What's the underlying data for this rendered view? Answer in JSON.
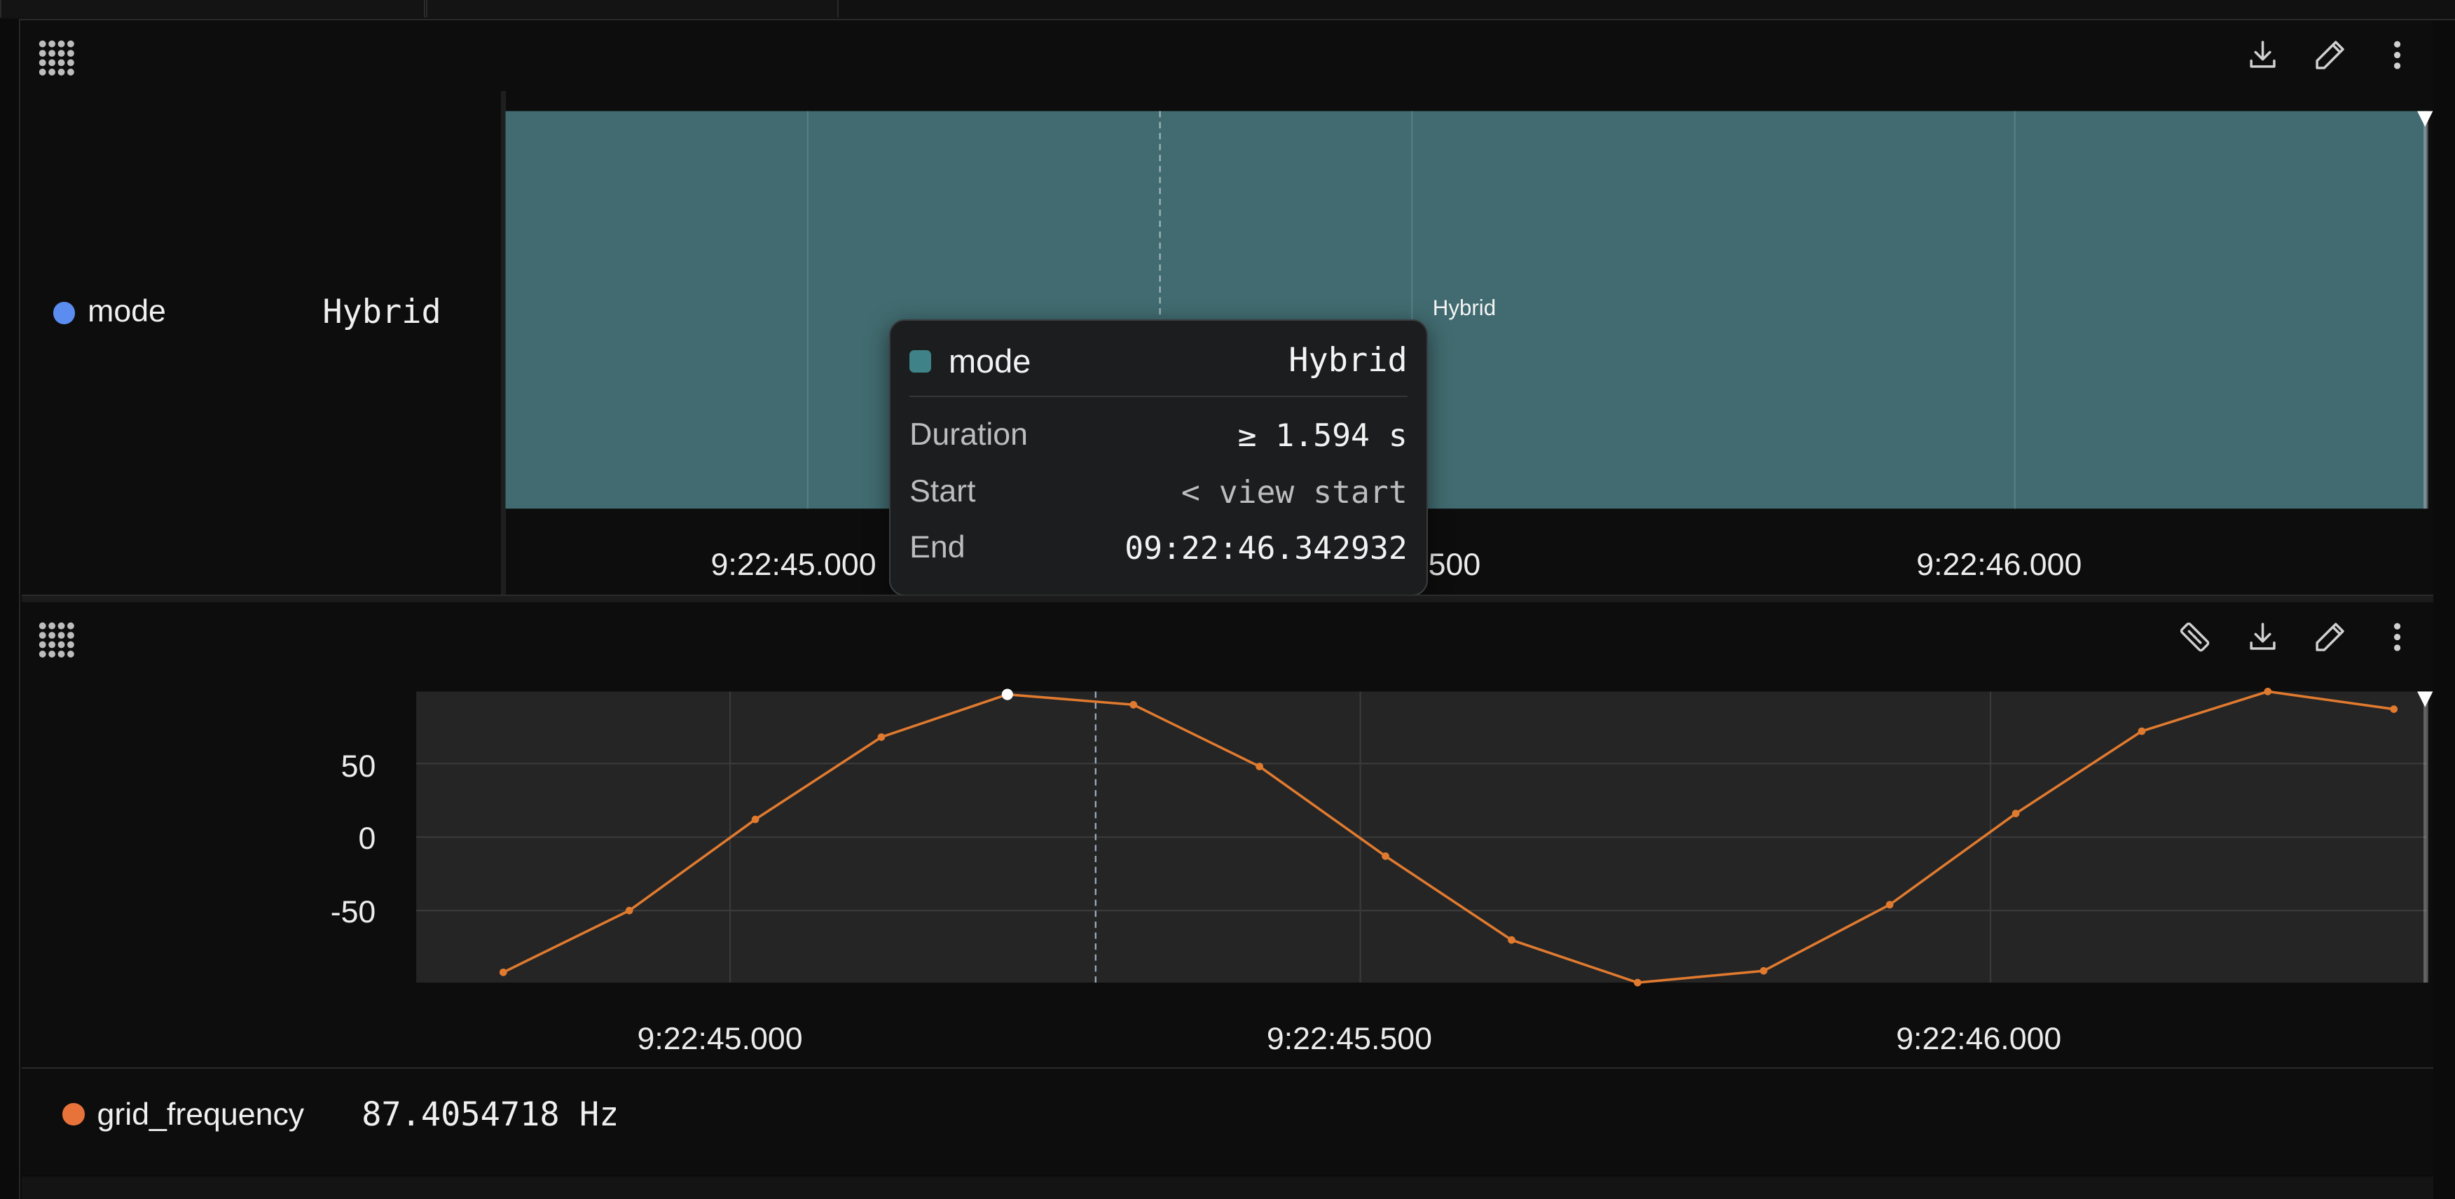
{
  "colors": {
    "band": "#416b70",
    "series_line": "#e07a2f",
    "mode_dot": "#5b8cf0",
    "frequency_dot": "#e8733a",
    "tooltip_swatch": "#3f8287"
  },
  "panel1": {
    "toolbar_icons": [
      "drag-grip-icon",
      "download-icon",
      "pencil-icon",
      "more-vertical-icon"
    ],
    "legend": {
      "name": "mode",
      "value": "Hybrid"
    },
    "band_label": "Hybrid",
    "x_ticks": [
      "9:22:45.000",
      "9:22:45.500",
      "9:22:46.000"
    ]
  },
  "tooltip": {
    "series": "mode",
    "value": "Hybrid",
    "rows": [
      {
        "key": "Duration",
        "value": "≥ 1.594 s"
      },
      {
        "key": "Start",
        "value": "< view start"
      },
      {
        "key": "End",
        "value": "09:22:46.342932"
      }
    ]
  },
  "panel2": {
    "toolbar_icons": [
      "drag-grip-icon",
      "ruler-icon",
      "download-icon",
      "pencil-icon",
      "more-vertical-icon"
    ],
    "legend": {
      "name": "grid_frequency",
      "value": "87.4054718 Hz"
    },
    "y_ticks": [
      "50",
      "0",
      "-50"
    ],
    "x_ticks": [
      "9:22:45.000",
      "9:22:45.500",
      "9:22:46.000"
    ]
  },
  "chart_data": {
    "type": "line",
    "series": [
      {
        "name": "grid_frequency",
        "x": [
          "09:22:44.820",
          "09:22:44.920",
          "09:22:45.020",
          "09:22:45.120",
          "09:22:45.220",
          "09:22:45.320",
          "09:22:45.420",
          "09:22:45.520",
          "09:22:45.620",
          "09:22:45.720",
          "09:22:45.820",
          "09:22:45.920",
          "09:22:46.020",
          "09:22:46.120",
          "09:22:46.220",
          "09:22:46.320"
        ],
        "y": [
          -92,
          -50,
          12,
          68,
          97,
          90,
          48,
          -13,
          -70,
          -99,
          -91,
          -46,
          16,
          72,
          99,
          87
        ]
      }
    ],
    "y_ticks": [
      50,
      0,
      -50
    ],
    "ylim": [
      -99,
      99
    ],
    "x_ticks": [
      "9:22:45.000",
      "9:22:45.500",
      "9:22:46.000"
    ],
    "xlim": [
      "09:22:44.751",
      "09:22:46.346"
    ],
    "hover_x": "09:22:45.290",
    "highlight_point_index": 4,
    "grid": true
  }
}
